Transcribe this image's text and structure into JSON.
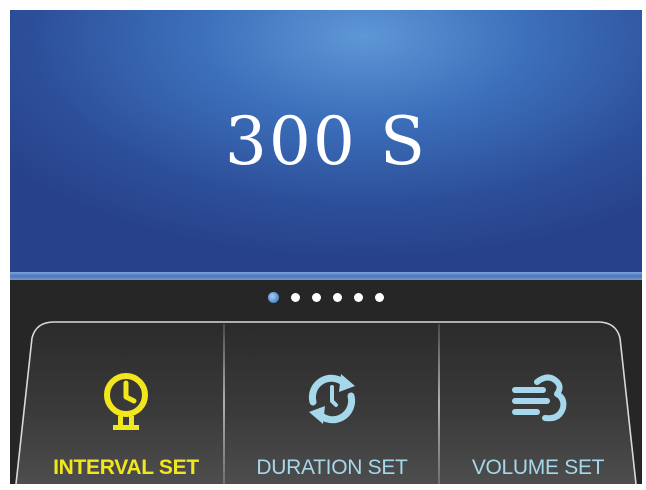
{
  "display": {
    "value": "300 S"
  },
  "pager": {
    "count": 6,
    "active_index": 0
  },
  "buttons": [
    {
      "label": "INTERVAL SET",
      "icon": "clock-icon",
      "state": "selected",
      "color": "#f2e61c"
    },
    {
      "label": "DURATION SET",
      "icon": "cycle-arrows-icon",
      "state": "normal",
      "color": "#a4d8ea"
    },
    {
      "label": "VOLUME SET",
      "icon": "airflow-icon",
      "state": "normal",
      "color": "#a4d8ea"
    }
  ],
  "colors": {
    "screen": "#3c6fba",
    "panel": "#262626",
    "accent_selected": "#f2e61c",
    "accent_normal": "#a4d8ea"
  }
}
